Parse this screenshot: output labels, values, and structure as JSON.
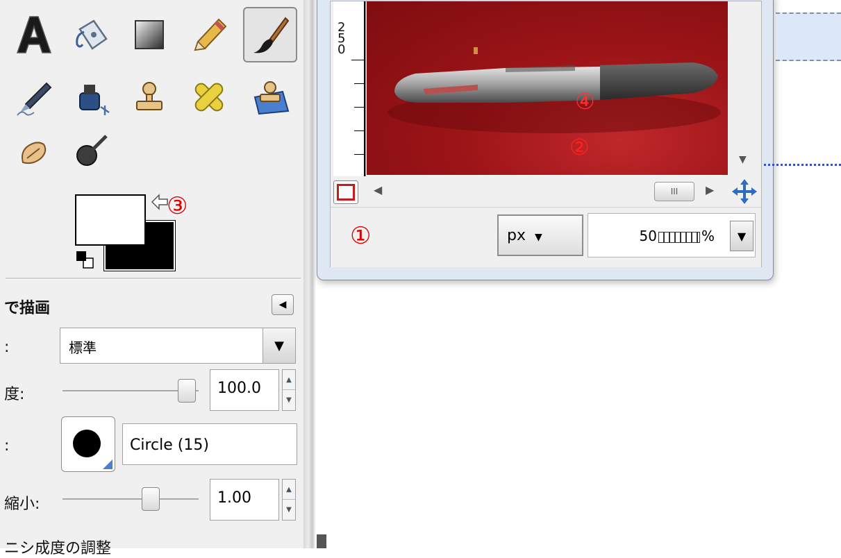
{
  "toolbox": {
    "tools": [
      {
        "name": "text-tool-icon",
        "active": false
      },
      {
        "name": "bucket-fill-tool-icon",
        "active": false
      },
      {
        "name": "blend-tool-icon",
        "active": false
      },
      {
        "name": "pencil-tool-icon",
        "active": false
      },
      {
        "name": "paintbrush-tool-icon",
        "active": true
      },
      {
        "name": "airbrush-tool-icon",
        "active": false
      },
      {
        "name": "ink-tool-icon",
        "active": false
      },
      {
        "name": "clone-tool-icon",
        "active": false
      },
      {
        "name": "heal-tool-icon",
        "active": false
      },
      {
        "name": "perspective-clone-tool-icon",
        "active": false
      },
      {
        "name": "smudge-tool-icon",
        "active": false
      },
      {
        "name": "dodge-burn-tool-icon",
        "active": false
      }
    ],
    "markers": {
      "swap": "③"
    }
  },
  "tool_options": {
    "title": "で描画",
    "mode_label": ":",
    "mode_value": "標準",
    "opacity_label": "度:",
    "opacity_value": "100.0",
    "opacity_fraction": 1.0,
    "brush_label": ":",
    "brush_name": "Circle (15)",
    "scale_label": "縮小:",
    "scale_value": "1.00",
    "next_section": "ニシ成度の調整"
  },
  "image_window": {
    "ruler_numbers": [
      "2",
      "5",
      "0"
    ],
    "markers": {
      "status": "①",
      "canvas_lower": "②",
      "canvas_upper": "④"
    },
    "unit": "px",
    "zoom_value": "50",
    "zoom_suffix": "%",
    "hscroll_thumb": "III"
  },
  "colors": {
    "foreground": "#ffffff",
    "background": "#000000",
    "marker": "#e00000",
    "canvas": "#9c1417"
  }
}
